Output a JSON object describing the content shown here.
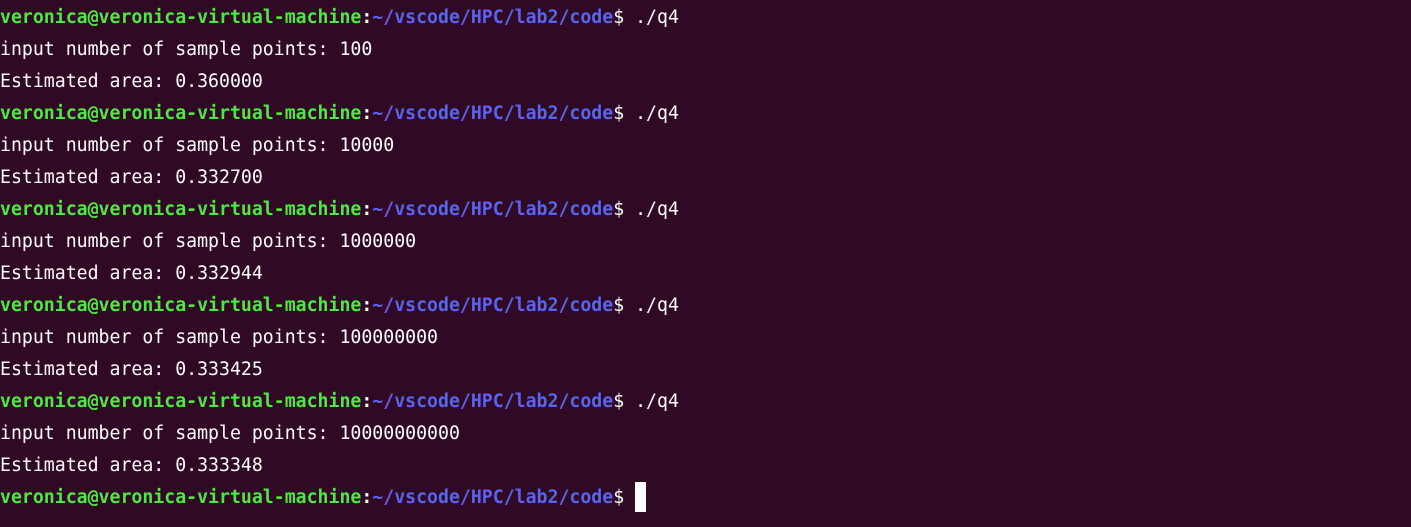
{
  "terminal": {
    "colors": {
      "background": "#300a24",
      "user_host": "#4ee940",
      "path": "#5b63f0",
      "text": "#ffffff"
    },
    "lines": [
      {
        "user_host": "veronica@veronica-virtual-machine",
        "sep": ":",
        "path": "~/vscode/HPC/lab2/code",
        "symbol": "$",
        "command": " ./q4"
      },
      {
        "text": "input number of sample points: 100"
      },
      {
        "text": "Estimated area: 0.360000"
      },
      {
        "user_host": "veronica@veronica-virtual-machine",
        "sep": ":",
        "path": "~/vscode/HPC/lab2/code",
        "symbol": "$",
        "command": " ./q4"
      },
      {
        "text": "input number of sample points: 10000"
      },
      {
        "text": "Estimated area: 0.332700"
      },
      {
        "user_host": "veronica@veronica-virtual-machine",
        "sep": ":",
        "path": "~/vscode/HPC/lab2/code",
        "symbol": "$",
        "command": " ./q4"
      },
      {
        "text": "input number of sample points: 1000000"
      },
      {
        "text": "Estimated area: 0.332944"
      },
      {
        "user_host": "veronica@veronica-virtual-machine",
        "sep": ":",
        "path": "~/vscode/HPC/lab2/code",
        "symbol": "$",
        "command": " ./q4"
      },
      {
        "text": "input number of sample points: 100000000"
      },
      {
        "text": "Estimated area: 0.333425"
      },
      {
        "user_host": "veronica@veronica-virtual-machine",
        "sep": ":",
        "path": "~/vscode/HPC/lab2/code",
        "symbol": "$",
        "command": " ./q4"
      },
      {
        "text": "input number of sample points: 10000000000"
      },
      {
        "text": "Estimated area: 0.333348"
      },
      {
        "user_host": "veronica@veronica-virtual-machine",
        "sep": ":",
        "path": "~/vscode/HPC/lab2/code",
        "symbol": "$",
        "command": " "
      }
    ]
  }
}
